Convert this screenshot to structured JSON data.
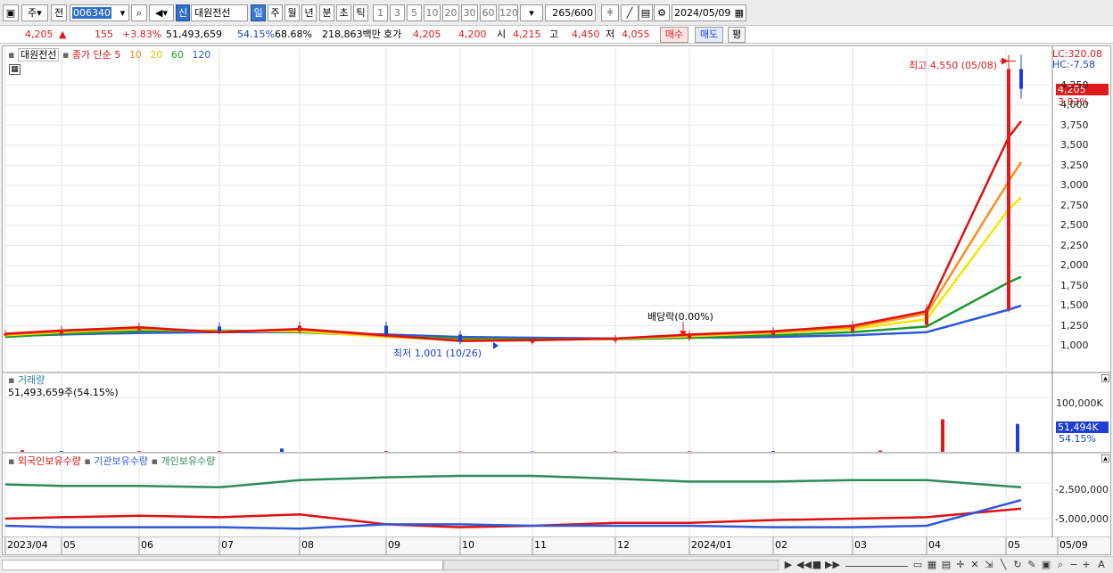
{
  "toolbar": {
    "market_toggle": "주",
    "prev_label": "전",
    "code": "006340",
    "new_badge": "신",
    "name": "대원전선",
    "periods": [
      "일",
      "주",
      "월",
      "년",
      "분",
      "초",
      "틱"
    ],
    "active_period": "일",
    "intervals": [
      "1",
      "3",
      "5",
      "10",
      "20",
      "30",
      "60",
      "120"
    ],
    "count_value": "265",
    "count_total": "/600",
    "date": "2024/05/09"
  },
  "quote": {
    "price": "4,205",
    "change": "155",
    "change_pct": "+3.83%",
    "volume": "51,493,659",
    "vol_pct": "54.15%",
    "ratio": "68.68%",
    "amount": "218,863백만",
    "bid_ask_label": "호가",
    "ask": "4,205",
    "bid": "4,200",
    "open_label": "시",
    "open": "4,215",
    "high_label": "고",
    "high": "4,450",
    "low_label": "저",
    "low": "4,055",
    "buy_label": "매수",
    "sell_label": "매도",
    "eval_label": "평"
  },
  "price_panel": {
    "stock_label": "대원전선",
    "ma_title": "종가 단순",
    "ma_periods": [
      "5",
      "10",
      "20",
      "60",
      "120"
    ],
    "lc": "LC:320.08",
    "hc": "HC:-7.58",
    "current_price": "4,205",
    "current_pct": "3.83%",
    "high_note": "최고 4,550 (05/08)",
    "low_note": "최저 1,001 (10/26)",
    "dividend_note": "배당락(0.00%)",
    "y_ticks": [
      "4,250",
      "4,000",
      "3,750",
      "3,500",
      "3,250",
      "3,000",
      "2,750",
      "2,500",
      "2,250",
      "2,000",
      "1,750",
      "1,500",
      "1,250",
      "1,000"
    ]
  },
  "volume_panel": {
    "title": "거래량",
    "value": "51,493,659주(54.15%)",
    "tick": "100,000K",
    "current": "51,494K",
    "current_pct": "54.15%"
  },
  "holdings_panel": {
    "series": [
      "외국인보유수량",
      "기관보유수량",
      "개인보유수량"
    ],
    "ticks": [
      "-2,500,000",
      "-5,000,000"
    ]
  },
  "x_axis": [
    "2023/04",
    "05",
    "06",
    "07",
    "08",
    "09",
    "10",
    "11",
    "12",
    "2024/01",
    "02",
    "03",
    "04",
    "05",
    "05/09"
  ],
  "colors": {
    "up": "#e11b1b",
    "down": "#1f3fd0",
    "ma5": "#dd1111",
    "ma10": "#ff8c1a",
    "ma20": "#f5e600",
    "ma60": "#1d9a2e",
    "ma120": "#3358d8",
    "foreign": "#dd1111",
    "institution": "#3358d8",
    "individual": "#2e8b57"
  },
  "chart_data": [
    {
      "type": "line",
      "name": "price-candles-moving-averages",
      "x": [
        "2023/04",
        "05",
        "06",
        "07",
        "08",
        "09",
        "10",
        "11",
        "12",
        "2024/01",
        "02",
        "03",
        "04",
        "05/08",
        "05/09"
      ],
      "series": [
        {
          "name": "close",
          "values": [
            1150,
            1200,
            1240,
            1180,
            1250,
            1140,
            1050,
            1060,
            1090,
            1140,
            1180,
            1260,
            1460,
            4450,
            4205
          ]
        },
        {
          "name": "5",
          "values": [
            1150,
            1190,
            1230,
            1170,
            1210,
            1130,
            1060,
            1070,
            1090,
            1140,
            1180,
            1250,
            1430,
            3600,
            3800
          ]
        },
        {
          "name": "10",
          "values": [
            1140,
            1180,
            1220,
            1170,
            1200,
            1120,
            1070,
            1070,
            1090,
            1130,
            1170,
            1230,
            1400,
            3050,
            3290
          ]
        },
        {
          "name": "20",
          "values": [
            1130,
            1170,
            1210,
            1180,
            1180,
            1110,
            1070,
            1070,
            1085,
            1120,
            1160,
            1210,
            1330,
            2700,
            2850
          ]
        },
        {
          "name": "60",
          "values": [
            1110,
            1150,
            1180,
            1190,
            1170,
            1120,
            1090,
            1080,
            1080,
            1100,
            1130,
            1170,
            1240,
            1790,
            1860
          ]
        },
        {
          "name": "120",
          "values": [
            1120,
            1140,
            1160,
            1170,
            1170,
            1140,
            1110,
            1100,
            1090,
            1100,
            1110,
            1130,
            1170,
            1450,
            1500
          ]
        }
      ],
      "ylim": [
        900,
        4600
      ]
    },
    {
      "type": "bar",
      "name": "volume",
      "x": [
        "04",
        "05",
        "06",
        "07",
        "08",
        "09",
        "10",
        "11",
        "12",
        "01",
        "02",
        "03",
        "04",
        "05"
      ],
      "values": [
        3000,
        1500,
        1500,
        1500,
        6000,
        1500,
        800,
        800,
        1000,
        1200,
        1500,
        2500,
        60000,
        51494
      ],
      "ylabel": "K"
    },
    {
      "type": "line",
      "name": "holdings",
      "x": [
        "2023/04",
        "05",
        "06",
        "07",
        "08",
        "09",
        "10",
        "11",
        "12",
        "2024/01",
        "02",
        "03",
        "04",
        "05"
      ],
      "series": [
        {
          "name": "외국인보유수량",
          "values": [
            -5000000,
            -4900000,
            -4800000,
            -4900000,
            -4700000,
            -5400000,
            -5600000,
            -5500000,
            -5300000,
            -5300000,
            -5100000,
            -5000000,
            -4900000,
            -4300000
          ]
        },
        {
          "name": "기관보유수량",
          "values": [
            -5500000,
            -5600000,
            -5600000,
            -5600000,
            -5700000,
            -5400000,
            -5400000,
            -5500000,
            -5500000,
            -5500000,
            -5600000,
            -5600000,
            -5500000,
            -3700000
          ]
        },
        {
          "name": "개인보유수량",
          "values": [
            -2600000,
            -2700000,
            -2700000,
            -2800000,
            -2300000,
            -2100000,
            -2000000,
            -2000000,
            -2200000,
            -2400000,
            -2400000,
            -2300000,
            -2300000,
            -2800000
          ]
        }
      ]
    }
  ]
}
